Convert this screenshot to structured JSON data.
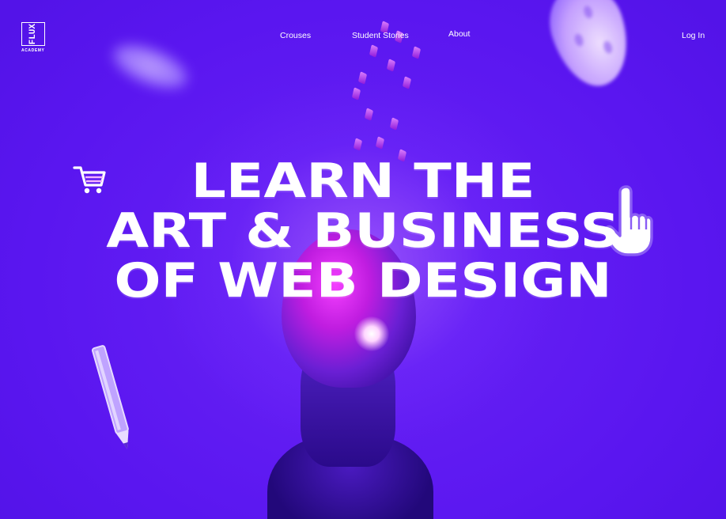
{
  "brand": {
    "logo_mark": "FLUX",
    "logo_sub": "ACADEMY"
  },
  "nav": {
    "courses": "Crouses",
    "student_stories": "Student Stories",
    "about": "About",
    "login": "Log In"
  },
  "hero": {
    "line1": "LEARN THE",
    "line2": "ART & BUSINESS",
    "line3": "OF WEB DESIGN"
  },
  "colors": {
    "background": "#5a16f0",
    "accent": "#e13cff",
    "text": "#ffffff"
  },
  "icons": [
    "shopping-cart-icon",
    "pointing-hand-icon",
    "pencil-icon"
  ]
}
